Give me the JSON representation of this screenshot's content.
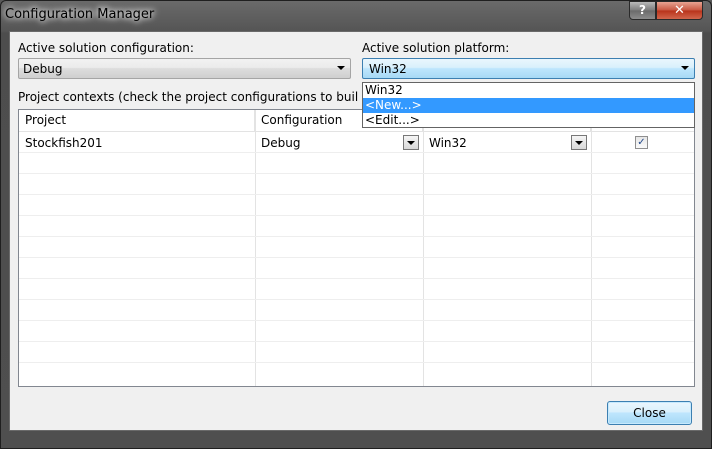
{
  "window": {
    "title": "Configuration Manager",
    "help_label": "?",
    "close_label": "✕"
  },
  "active_config": {
    "label": "Active solution configuration:",
    "value": "Debug"
  },
  "active_platform": {
    "label": "Active solution platform:",
    "value": "Win32",
    "dropdown_items": [
      "Win32",
      "<New...>",
      "<Edit...>"
    ],
    "selected_index": 1
  },
  "project_contexts_label": "Project contexts (check the project configurations to build or deploy):",
  "grid": {
    "headers": [
      "Project",
      "Configuration"
    ],
    "rows": [
      {
        "project": "Stockfish201",
        "configuration": "Debug",
        "platform": "Win32",
        "build": true
      }
    ]
  },
  "buttons": {
    "close": "Close"
  }
}
